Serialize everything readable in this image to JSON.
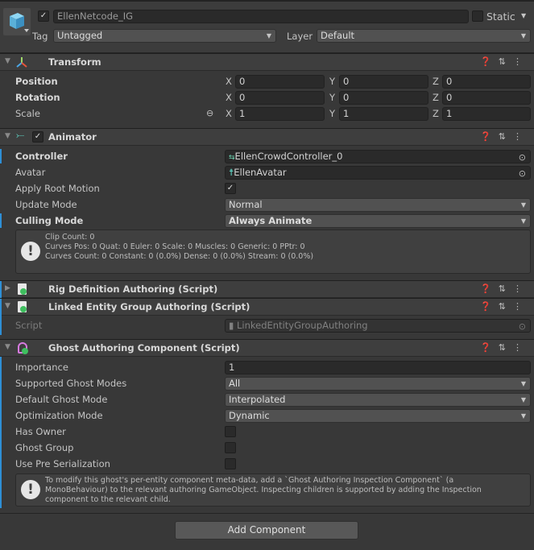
{
  "gameobject": {
    "active": true,
    "name": "EllenNetcode_IG",
    "static_label": "Static",
    "static": false,
    "tag_label": "Tag",
    "tag": "Untagged",
    "layer_label": "Layer",
    "layer": "Default"
  },
  "transform": {
    "title": "Transform",
    "rows": [
      {
        "label": "Position",
        "x": "0",
        "y": "0",
        "z": "0"
      },
      {
        "label": "Rotation",
        "x": "0",
        "y": "0",
        "z": "0"
      },
      {
        "label": "Scale",
        "x": "1",
        "y": "1",
        "z": "1"
      }
    ]
  },
  "axes": {
    "x": "X",
    "y": "Y",
    "z": "Z"
  },
  "animator": {
    "title": "Animator",
    "enabled": true,
    "controller_label": "Controller",
    "controller": "EllenCrowdController_0",
    "avatar_label": "Avatar",
    "avatar": "EllenAvatar",
    "root_motion_label": "Apply Root Motion",
    "root_motion": true,
    "update_mode_label": "Update Mode",
    "update_mode": "Normal",
    "culling_mode_label": "Culling Mode",
    "culling_mode": "Always Animate",
    "info": [
      "Clip Count: 0",
      "Curves Pos: 0 Quat: 0 Euler: 0 Scale: 0 Muscles: 0 Generic: 0 PPtr: 0",
      "Curves Count: 0 Constant: 0 (0.0%) Dense: 0 (0.0%) Stream: 0 (0.0%)"
    ]
  },
  "rig": {
    "title": "Rig Definition Authoring (Script)"
  },
  "linked": {
    "title": "Linked Entity Group Authoring (Script)",
    "script_label": "Script",
    "script": "LinkedEntityGroupAuthoring"
  },
  "ghost": {
    "title": "Ghost Authoring Component (Script)",
    "importance_label": "Importance",
    "importance": "1",
    "supported_label": "Supported Ghost Modes",
    "supported": "All",
    "default_label": "Default Ghost Mode",
    "default": "Interpolated",
    "optimization_label": "Optimization Mode",
    "optimization": "Dynamic",
    "has_owner_label": "Has Owner",
    "has_owner": false,
    "ghost_group_label": "Ghost Group",
    "ghost_group": false,
    "pre_serialization_label": "Use Pre Serialization",
    "pre_serialization": false,
    "info": [
      "To modify this ghost's per-entity component meta-data, add a `Ghost Authoring Inspection Component` (a",
      "MonoBehaviour) to the relevant authoring GameObject. Inspecting children is supported by adding the Inspection",
      "component to the relevant child."
    ]
  },
  "add_component": "Add Component"
}
